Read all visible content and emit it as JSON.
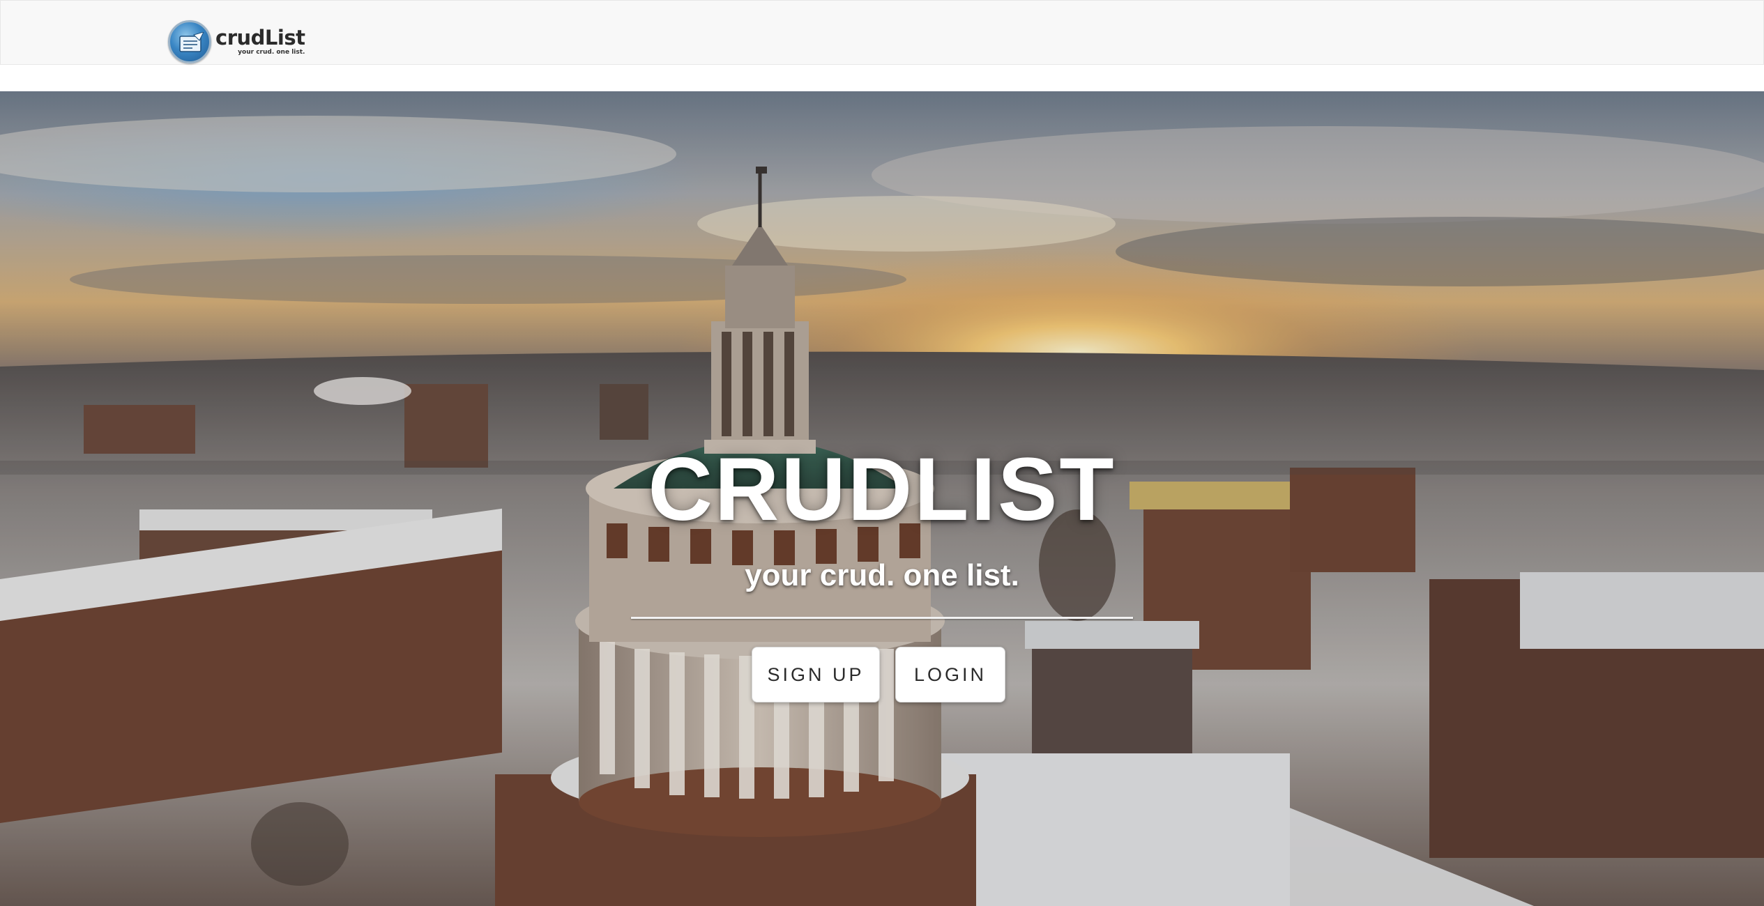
{
  "navbar": {
    "brand": {
      "name": "crudList",
      "tagline": "your crud. one list.",
      "icon": "crudlist-logo-icon"
    }
  },
  "hero": {
    "background": "aerial-campus-sunset-photo",
    "title": "CRUDLIST",
    "subtitle": "your crud. one list.",
    "buttons": {
      "signup_label": "SIGN UP",
      "login_label": "LOGIN"
    }
  },
  "colors": {
    "navbar_bg": "#f8f8f8",
    "navbar_border": "#e7e7e7",
    "hero_text": "#ffffff",
    "button_bg": "#ffffff",
    "button_text": "#2b2b2b"
  }
}
